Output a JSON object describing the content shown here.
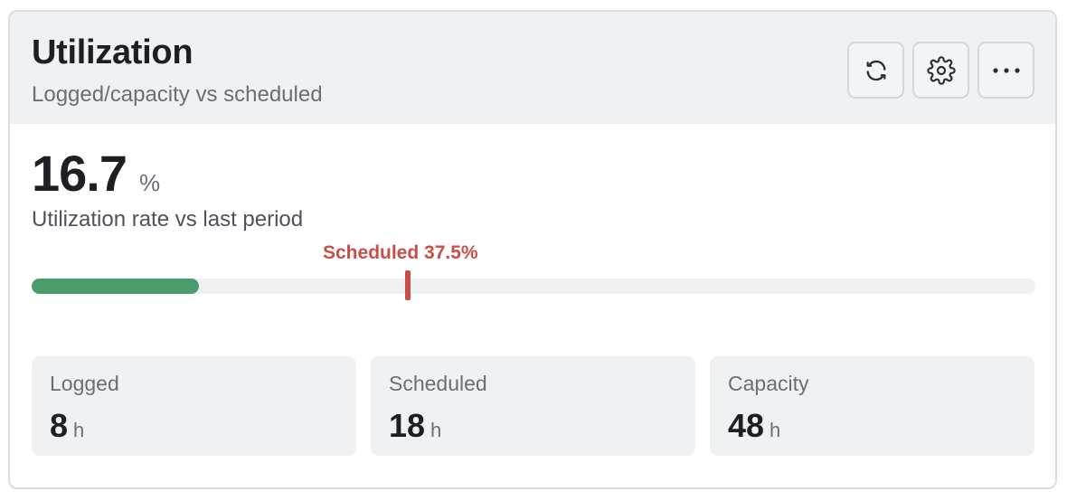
{
  "header": {
    "title": "Utilization",
    "subtitle": "Logged/capacity vs scheduled",
    "actions": [
      {
        "icon": "refresh-icon",
        "label": "Refresh"
      },
      {
        "icon": "gear-icon",
        "label": "Settings"
      },
      {
        "icon": "more-icon",
        "label": "More"
      }
    ]
  },
  "metric": {
    "value": "16.7",
    "unit": "%",
    "caption": "Utilization rate vs last period"
  },
  "progress": {
    "logged_fraction": 0.167,
    "scheduled_fraction": 0.375,
    "marker_label": "Scheduled 37.5%"
  },
  "stats": [
    {
      "label": "Logged",
      "value": "8",
      "unit": "h"
    },
    {
      "label": "Scheduled",
      "value": "18",
      "unit": "h"
    },
    {
      "label": "Capacity",
      "value": "48",
      "unit": "h"
    }
  ],
  "colors": {
    "progress_fill": "#4b9b6c",
    "scheduled_marker": "#c65048",
    "header_background": "#f0f1f3"
  }
}
